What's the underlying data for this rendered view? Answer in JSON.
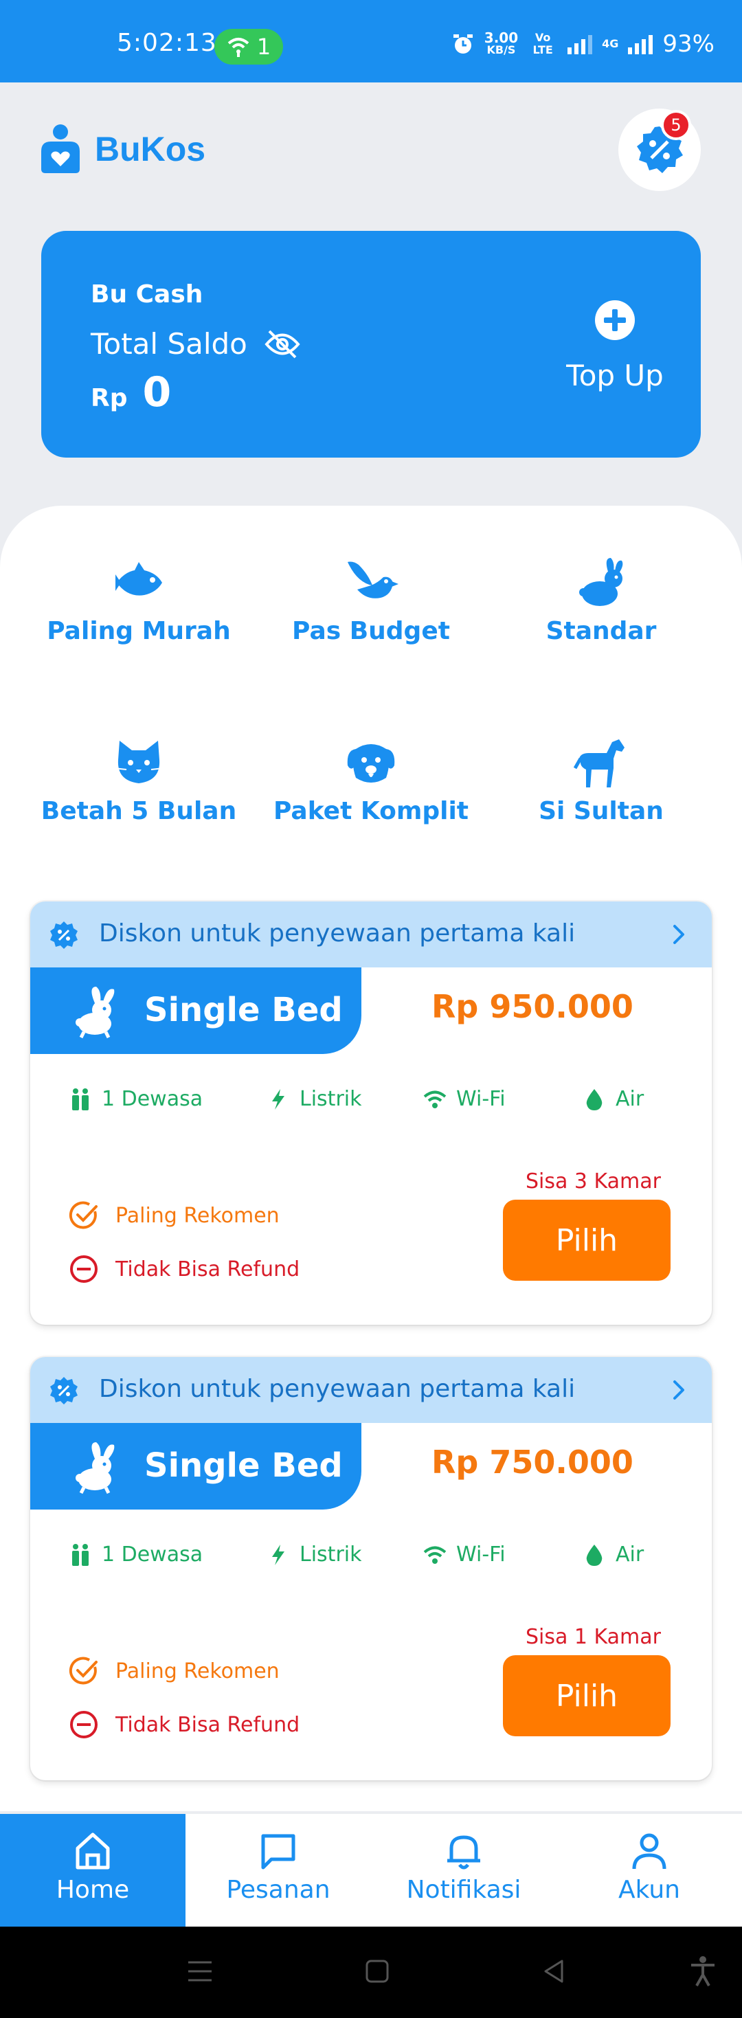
{
  "status_bar": {
    "time": "5:02:13",
    "hotspot_count": "1",
    "speed_value": "3.00",
    "speed_unit": "KB/S",
    "volte": "Vo LTE",
    "network": "4G",
    "battery": "93%"
  },
  "header": {
    "app_name": "BuKos",
    "promo_badge_count": "5"
  },
  "balance": {
    "label": "Bu Cash",
    "total_label": "Total Saldo",
    "currency": "Rp",
    "amount": "0",
    "topup_label": "Top Up"
  },
  "categories": [
    {
      "label": "Paling Murah",
      "icon": "fish-icon"
    },
    {
      "label": "Pas Budget",
      "icon": "bird-icon"
    },
    {
      "label": "Standar",
      "icon": "rabbit-icon"
    },
    {
      "label": "Betah 5 Bulan",
      "icon": "cat-icon"
    },
    {
      "label": "Paket Komplit",
      "icon": "dog-icon"
    },
    {
      "label": "Si Sultan",
      "icon": "horse-icon"
    }
  ],
  "rooms": [
    {
      "promo": "Diskon untuk penyewaan pertama kali",
      "name": "Single Bed",
      "price": "Rp 950.000",
      "facilities": [
        "1 Dewasa",
        "Listrik",
        "Wi-Fi",
        "Air"
      ],
      "tag_reco": "Paling Rekomen",
      "tag_refund": "Tidak Bisa Refund",
      "remaining": "Sisa 3 Kamar",
      "button": "Pilih"
    },
    {
      "promo": "Diskon untuk penyewaan pertama kali",
      "name": "Single Bed",
      "price": "Rp 750.000",
      "facilities": [
        "1 Dewasa",
        "Listrik",
        "Wi-Fi",
        "Air"
      ],
      "tag_reco": "Paling Rekomen",
      "tag_refund": "Tidak Bisa Refund",
      "remaining": "Sisa 1 Kamar",
      "button": "Pilih"
    }
  ],
  "bottom_nav": [
    {
      "label": "Home",
      "icon": "home-icon",
      "active": true
    },
    {
      "label": "Pesanan",
      "icon": "chat-icon",
      "active": false
    },
    {
      "label": "Notifikasi",
      "icon": "bell-icon",
      "active": false
    },
    {
      "label": "Akun",
      "icon": "user-icon",
      "active": false
    }
  ],
  "colors": {
    "primary": "#1a8ff0",
    "accent_orange": "#ff7a00",
    "price_orange": "#f5780f",
    "facility_green": "#1dab63",
    "danger_red": "#d81b28",
    "promo_strip": "#bfe0fb"
  }
}
